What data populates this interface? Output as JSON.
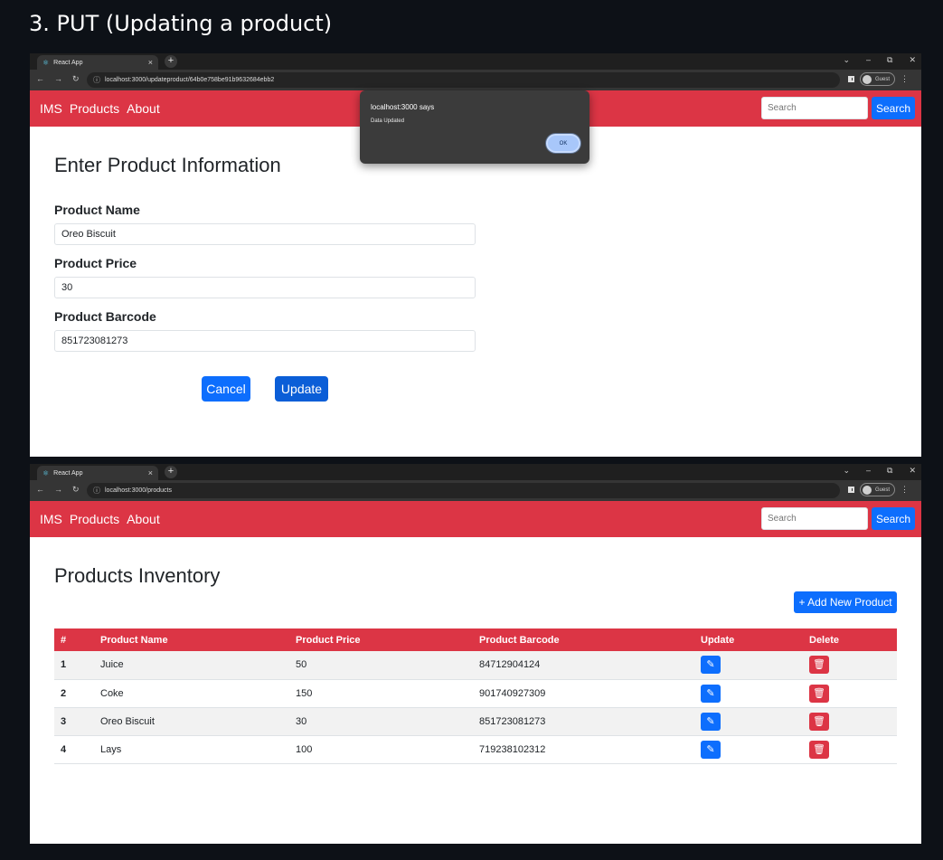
{
  "heading": "3. PUT (Updating a product)",
  "browser1": {
    "tab_title": "React App",
    "url": "localhost:3000/updateproduct/64b0e758be91b9632684ebb2",
    "guest_label": "Guest",
    "nav": {
      "brand": "IMS",
      "products": "Products",
      "about": "About",
      "search_placeholder": "Search",
      "search_button": "Search"
    },
    "form": {
      "title": "Enter Product Information",
      "name_label": "Product Name",
      "name_value": "Oreo Biscuit",
      "price_label": "Product Price",
      "price_value": "30",
      "barcode_label": "Product Barcode",
      "barcode_value": "851723081273",
      "cancel": "Cancel",
      "update": "Update"
    },
    "dialog": {
      "title": "localhost:3000 says",
      "message": "Data Updated",
      "ok": "OK"
    }
  },
  "browser2": {
    "tab_title": "React App",
    "url": "localhost:3000/products",
    "guest_label": "Guest",
    "nav": {
      "brand": "IMS",
      "products": "Products",
      "about": "About",
      "search_placeholder": "Search",
      "search_button": "Search"
    },
    "inventory": {
      "title": "Products Inventory",
      "add_button": "+ Add New Product",
      "columns": [
        "#",
        "Product Name",
        "Product Price",
        "Product Barcode",
        "Update",
        "Delete"
      ],
      "rows": [
        {
          "idx": "1",
          "name": "Juice",
          "price": "50",
          "barcode": "84712904124"
        },
        {
          "idx": "2",
          "name": "Coke",
          "price": "150",
          "barcode": "901740927309"
        },
        {
          "idx": "3",
          "name": "Oreo Biscuit",
          "price": "30",
          "barcode": "851723081273"
        },
        {
          "idx": "4",
          "name": "Lays",
          "price": "100",
          "barcode": "719238102312"
        }
      ]
    }
  },
  "colors": {
    "navbar": "#dc3545",
    "primary": "#0d6efd",
    "danger": "#dc3545",
    "page_bg": "#0d1117"
  },
  "icons": {
    "tab_favicon": "react-icon",
    "edit": "edit-icon",
    "delete": "trash-icon"
  }
}
